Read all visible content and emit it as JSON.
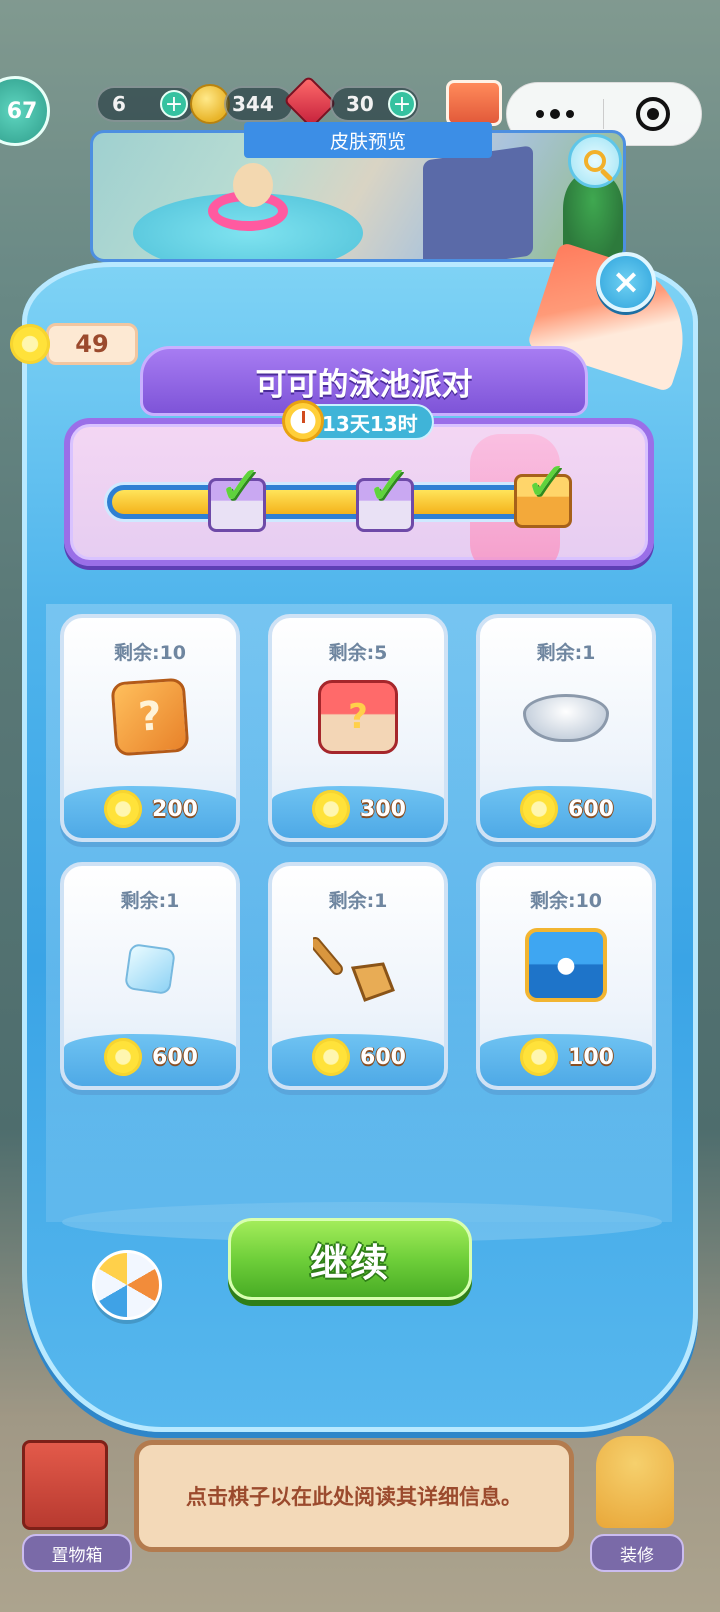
{
  "hud": {
    "level": "67",
    "energy": "6",
    "coins": "344",
    "gems": "30"
  },
  "preview": {
    "label": "皮肤预览"
  },
  "currency": {
    "amount": "49"
  },
  "event": {
    "title": "可可的泳池派对",
    "timer": "13天13时",
    "progress_fraction": 1.0,
    "milestones_completed": 3
  },
  "shop": {
    "items": [
      {
        "remaining": "剩余:10",
        "icon": "mystery-box-icon",
        "price": "200"
      },
      {
        "remaining": "剩余:5",
        "icon": "red-chest-icon",
        "price": "300"
      },
      {
        "remaining": "剩余:1",
        "icon": "bowl-icon",
        "price": "600"
      },
      {
        "remaining": "剩余:1",
        "icon": "ice-cube-icon",
        "price": "600"
      },
      {
        "remaining": "剩余:1",
        "icon": "spatula-icon",
        "price": "600"
      },
      {
        "remaining": "剩余:10",
        "icon": "blue-chest-icon",
        "price": "100"
      }
    ]
  },
  "buttons": {
    "continue": "继续",
    "close": "×"
  },
  "bottom": {
    "info": "点击棋子以在此处阅读其详细信息。",
    "storage": "置物箱",
    "decorate": "装修"
  },
  "colors": {
    "panel": "#3aa4e6",
    "ribbon": "#7e54d8",
    "continue": "#6fcf3a",
    "price_flower": "#ffe23a"
  }
}
